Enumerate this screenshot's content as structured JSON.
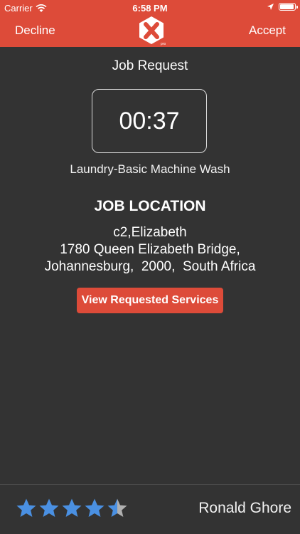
{
  "status_bar": {
    "carrier": "Carrier",
    "time": "6:58 PM",
    "battery_level": 0.95
  },
  "header": {
    "decline_label": "Decline",
    "accept_label": "Accept",
    "logo_icon": "x-logo-icon",
    "accent_color": "#dd4b39"
  },
  "job": {
    "title": "Job Request",
    "timer": "00:37",
    "service": "Laundry-Basic Machine Wash",
    "location_title": "JOB LOCATION",
    "address_lines": [
      "c2,Elizabeth",
      "1780 Queen Elizabeth Bridge,",
      "Johannesburg,  2000,  South Africa"
    ],
    "view_services_label": "View Requested Services"
  },
  "customer": {
    "name": "Ronald Ghore",
    "rating": 4.5,
    "rating_max": 5,
    "star_color": "#4a90e2"
  }
}
